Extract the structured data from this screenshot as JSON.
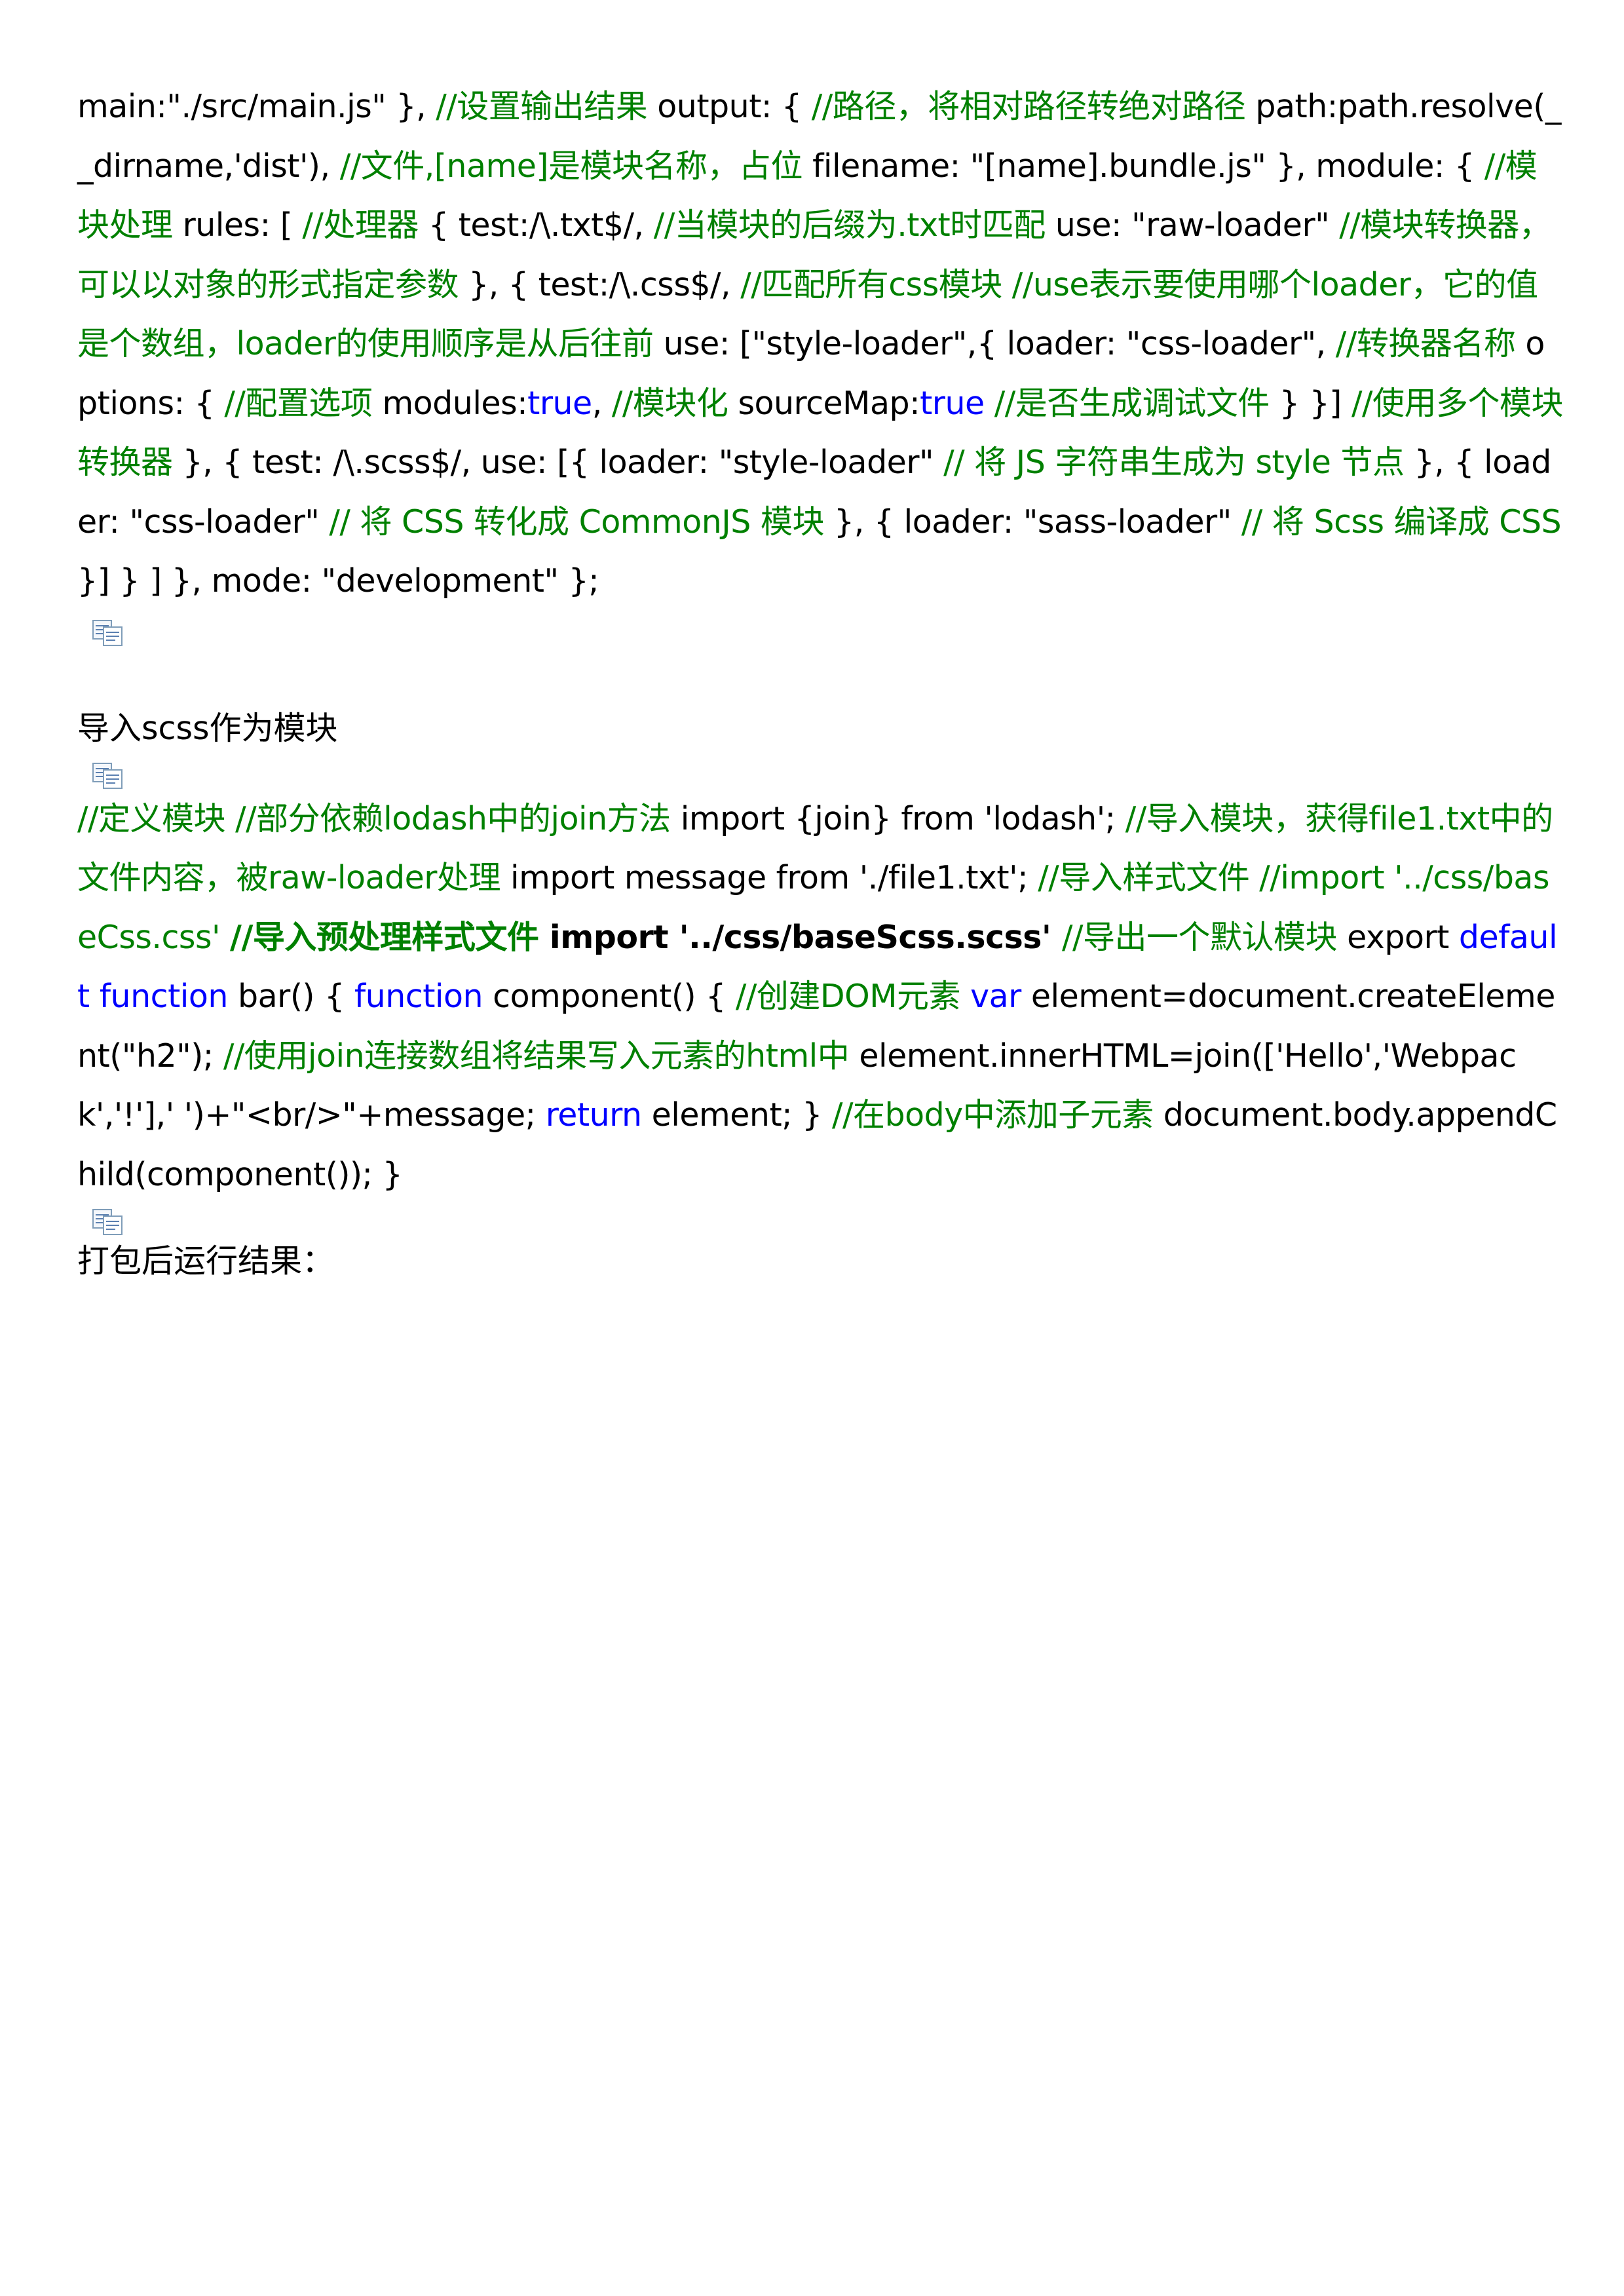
{
  "block1": {
    "segments": [
      {
        "text": "main:\"./src/main.js\" }, ",
        "style": "plain"
      },
      {
        "text": "//设置输出结果",
        "style": "comment"
      },
      {
        "text": " output: { ",
        "style": "plain"
      },
      {
        "text": "//路径，将相对路径转绝对路径",
        "style": "comment"
      },
      {
        "text": " path:path.resolve(__dirname,'dist'), ",
        "style": "plain"
      },
      {
        "text": "//文件,[name]是模块名称，占位",
        "style": "comment"
      },
      {
        "text": " filename: \"[name].bundle.js\" }, module: { ",
        "style": "plain"
      },
      {
        "text": "//模块处理",
        "style": "comment"
      },
      {
        "text": " rules: [ ",
        "style": "plain"
      },
      {
        "text": "//处理器",
        "style": "comment"
      },
      {
        "text": " { test:/\\.txt$/, ",
        "style": "plain"
      },
      {
        "text": "//当模块的后缀为.txt时匹配",
        "style": "comment"
      },
      {
        "text": " use: \"raw-loader\" ",
        "style": "plain"
      },
      {
        "text": "//模块转换器，可以以对象的形式指定参数",
        "style": "comment"
      },
      {
        "text": " }, { test:/\\.css$/, ",
        "style": "plain"
      },
      {
        "text": "//匹配所有css模块 //use表示要使用哪个loader，它的值是个数组，loader的使用顺序是从后往前",
        "style": "comment"
      },
      {
        "text": " use: [\"style-loader\",{ loader: \"css-loader\", ",
        "style": "plain"
      },
      {
        "text": "//转换器名称",
        "style": "comment"
      },
      {
        "text": " options: { ",
        "style": "plain"
      },
      {
        "text": "//配置选项",
        "style": "comment"
      },
      {
        "text": " modules:",
        "style": "plain"
      },
      {
        "text": "true",
        "style": "keyword"
      },
      {
        "text": ", ",
        "style": "plain"
      },
      {
        "text": "//模块化",
        "style": "comment"
      },
      {
        "text": " sourceMap:",
        "style": "plain"
      },
      {
        "text": "true",
        "style": "keyword"
      },
      {
        "text": " ",
        "style": "plain"
      },
      {
        "text": "//是否生成调试文件",
        "style": "comment"
      },
      {
        "text": " } }] ",
        "style": "plain"
      },
      {
        "text": "//使用多个模块转换器",
        "style": "comment"
      },
      {
        "text": " }, { test: /\\.scss$/, use: [{ loader: \"style-loader\" ",
        "style": "plain"
      },
      {
        "text": "// 将 JS 字符串生成为 style 节点",
        "style": "comment"
      },
      {
        "text": " }, { loader: \"css-loader\" ",
        "style": "plain"
      },
      {
        "text": "// 将 CSS 转化成 CommonJS 模块",
        "style": "comment"
      },
      {
        "text": " }, { loader: \"sass-loader\" ",
        "style": "plain"
      },
      {
        "text": "// 将 Scss 编译成 CSS",
        "style": "comment"
      },
      {
        "text": " }] } ] }, mode: \"development\" };",
        "style": "plain"
      }
    ]
  },
  "heading_import_scss": "导入scss作为模块",
  "block2": {
    "segments": [
      {
        "text": "//定义模块 //部分依赖lodash中的join方法",
        "style": "comment"
      },
      {
        "text": " import {join} from 'lodash'; ",
        "style": "plain"
      },
      {
        "text": "//导入模块，获得file1.txt中的文件内容，被raw-loader处理",
        "style": "comment"
      },
      {
        "text": " import message from './file1.txt'; ",
        "style": "plain"
      },
      {
        "text": "//导入样式文件 //import '../css/baseCss.css' ",
        "style": "comment"
      },
      {
        "text": "//导入预处理样式文件",
        "style": "comment-bold"
      },
      {
        "text": " import '../css/baseScss.scss' ",
        "style": "plain-bold"
      },
      {
        "text": "//导出一个默认模块",
        "style": "comment"
      },
      {
        "text": " export ",
        "style": "plain"
      },
      {
        "text": "default",
        "style": "keyword"
      },
      {
        "text": " ",
        "style": "plain"
      },
      {
        "text": "function",
        "style": "keyword"
      },
      {
        "text": " bar() { ",
        "style": "plain"
      },
      {
        "text": "function",
        "style": "keyword"
      },
      {
        "text": " component() { ",
        "style": "plain"
      },
      {
        "text": "//创建DOM元素",
        "style": "comment"
      },
      {
        "text": " ",
        "style": "plain"
      },
      {
        "text": "var",
        "style": "keyword"
      },
      {
        "text": " element=document.createElement(\"h2\"); ",
        "style": "plain"
      },
      {
        "text": "//使用join连接数组将结果写入元素的html中",
        "style": "comment"
      },
      {
        "text": " element.innerHTML=join(['Hello','Webpack','!'],' ')+\"<br/>\"+message; ",
        "style": "plain"
      },
      {
        "text": "return",
        "style": "keyword"
      },
      {
        "text": " element; } ",
        "style": "plain"
      },
      {
        "text": "//在body中添加子元素",
        "style": "comment"
      },
      {
        "text": " document.body.appendChild(component()); }",
        "style": "plain"
      }
    ]
  },
  "label_run_result": "打包后运行结果：",
  "icons": {
    "copy": "copy-icon"
  }
}
